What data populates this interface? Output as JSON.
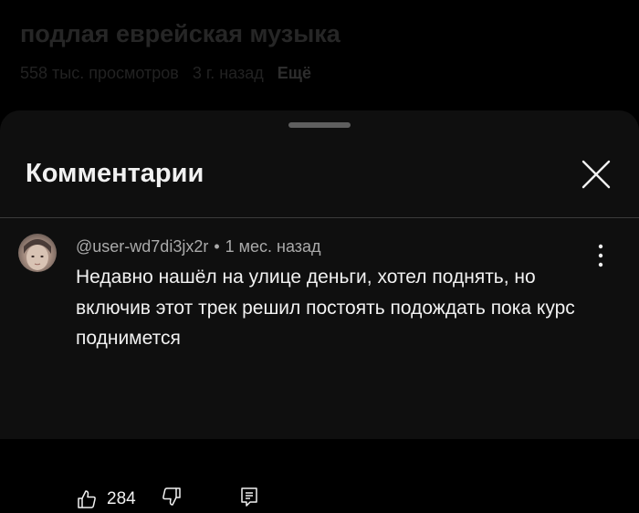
{
  "video": {
    "title": "подлая еврейская музыка",
    "views": "558 тыс. просмотров",
    "age": "3 г. назад",
    "more_label": "Ещё"
  },
  "comments_panel": {
    "title": "Комментарии",
    "close_icon": "close-icon"
  },
  "comment": {
    "author": "@user-wd7di3jx2r",
    "separator": "•",
    "time": "1 мес. назад",
    "text": "Недавно нашёл на улице деньги, хотел поднять, но включив этот трек решил постоять подождать пока курс поднимется",
    "likes": "284",
    "icons": [
      "like-icon",
      "dislike-icon",
      "reply-icon",
      "more-vertical-icon"
    ]
  },
  "colors": {
    "background": "#000000",
    "sheet": "#0f0f0f",
    "primary_text": "#f1f1f1",
    "secondary_text": "#aaaaaa"
  }
}
